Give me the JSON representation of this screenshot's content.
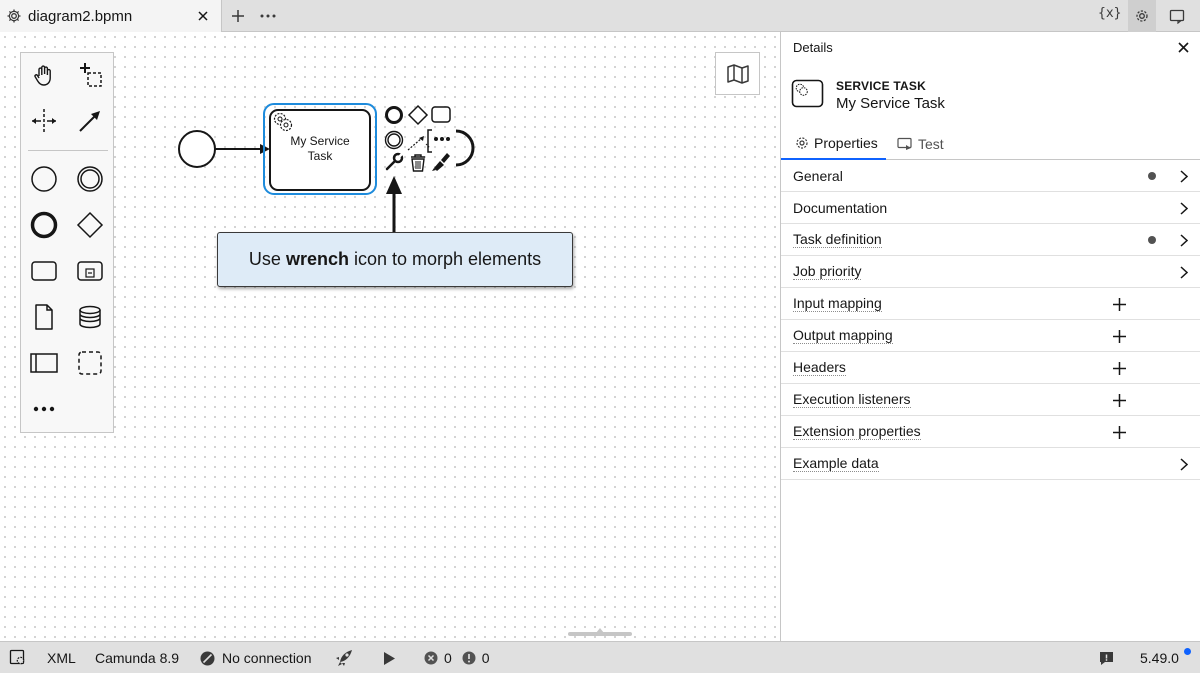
{
  "tabs": [
    {
      "label": "diagram2.bpmn",
      "icon": "settings-gear-icon"
    }
  ],
  "toolbar_right": {
    "variables_label": "{x}"
  },
  "canvas": {
    "elements": {
      "service_task_label_line1": "My Service",
      "service_task_label_line2": "Task"
    },
    "tooltip": {
      "prefix": "Use ",
      "bold": "wrench",
      "suffix": " icon to morph elements"
    }
  },
  "panel": {
    "title": "Details",
    "element_type": "SERVICE TASK",
    "element_name": "My Service Task",
    "tabs": [
      {
        "label": "Properties",
        "active": true
      },
      {
        "label": "Test",
        "active": false
      }
    ],
    "groups": [
      {
        "label": "General",
        "has_dot": true,
        "action": "expand"
      },
      {
        "label": "Documentation",
        "has_dot": false,
        "action": "expand"
      },
      {
        "label": "Task definition",
        "has_dot": true,
        "action": "expand"
      },
      {
        "label": "Job priority",
        "has_dot": false,
        "action": "expand"
      },
      {
        "label": "Input mapping",
        "has_dot": false,
        "action": "add"
      },
      {
        "label": "Output mapping",
        "has_dot": false,
        "action": "add"
      },
      {
        "label": "Headers",
        "has_dot": false,
        "action": "add"
      },
      {
        "label": "Execution listeners",
        "has_dot": false,
        "action": "add"
      },
      {
        "label": "Extension properties",
        "has_dot": false,
        "action": "add"
      },
      {
        "label": "Example data",
        "has_dot": false,
        "action": "expand"
      }
    ]
  },
  "statusbar": {
    "xml_label": "XML",
    "engine": "Camunda 8.9",
    "connection": "No connection",
    "errors": "0",
    "warnings": "0",
    "version": "5.49.0"
  },
  "colors": {
    "accent": "#0f62fe",
    "selection": "#1d8bdc",
    "tooltip_bg": "#deebf7"
  }
}
